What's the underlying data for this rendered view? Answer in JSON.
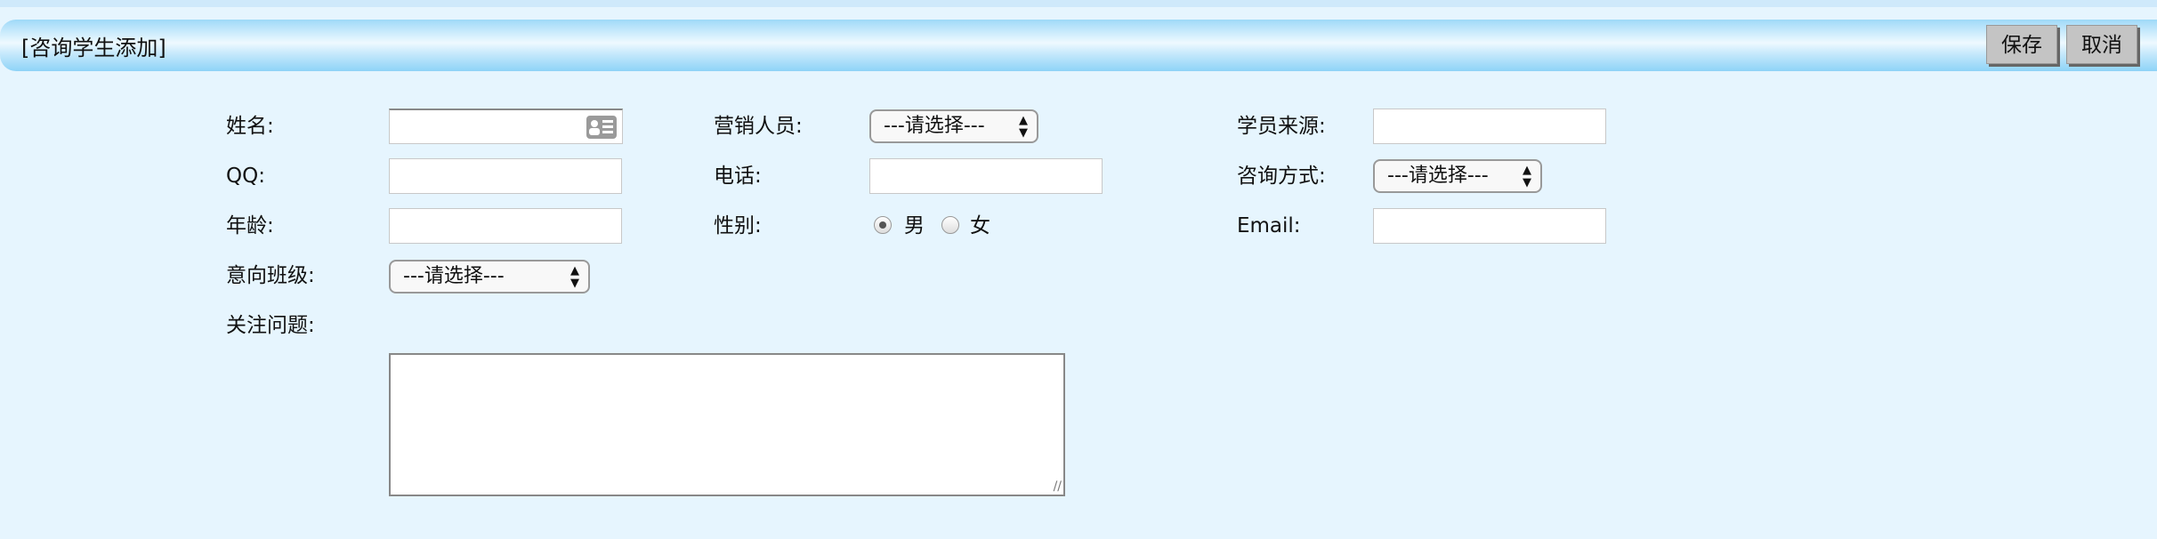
{
  "header": {
    "title": "[咨询学生添加]",
    "save_label": "保存",
    "cancel_label": "取消"
  },
  "form": {
    "name_label": "姓名:",
    "marketer_label": "营销人员:",
    "marketer_value": "---请选择---",
    "source_label": "学员来源:",
    "qq_label": "QQ:",
    "phone_label": "电话:",
    "consult_method_label": "咨询方式:",
    "consult_method_value": "---请选择---",
    "age_label": "年龄:",
    "gender_label": "性别:",
    "gender_options": [
      "男",
      "女"
    ],
    "gender_selected": "男",
    "email_label": "Email:",
    "class_label": "意向班级:",
    "class_value": "---请选择---",
    "concern_label": "关注问题:",
    "name_value": "",
    "qq_value": "",
    "age_value": "",
    "phone_value": "",
    "source_value": "",
    "email_value": "",
    "concern_value": ""
  }
}
